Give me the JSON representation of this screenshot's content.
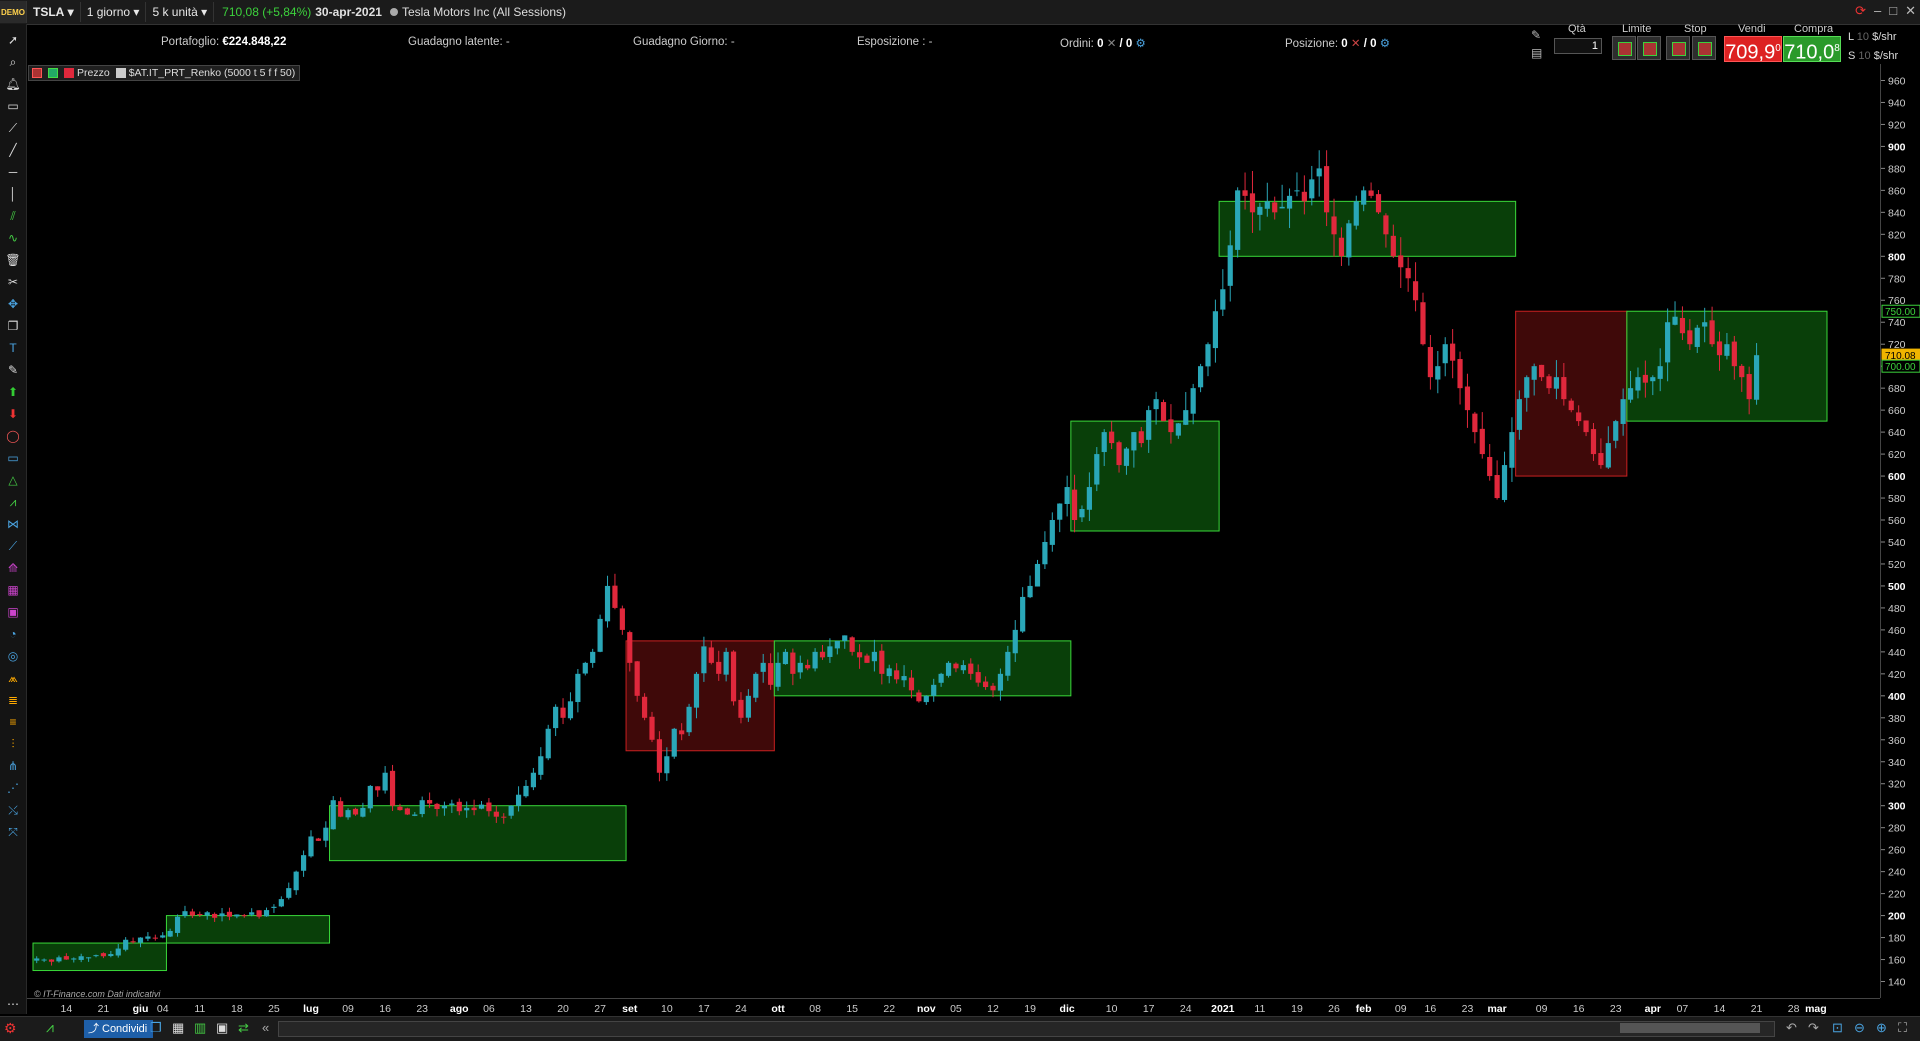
{
  "topbar": {
    "symbol": "TSLA",
    "timeframe": "1 giorno",
    "units": "5 k unità",
    "last_price": "710,08 (+5,84%)",
    "date": "30-apr-2021",
    "instrument": "Tesla Motors Inc (All Sessions)",
    "logo_text": "DEMO"
  },
  "infobar": {
    "portfolio_label": "Portafoglio:",
    "portfolio_value": "€224.848,22",
    "latent_label": "Guadagno latente:",
    "latent_value": "-",
    "daily_label": "Guadagno Giorno:",
    "daily_value": "-",
    "exposure_label": "Esposizione :",
    "exposure_value": "-",
    "orders_label": "Ordini:",
    "orders_value": "0",
    "orders_value2": "/ 0",
    "position_label": "Posizione:",
    "position_value": "0",
    "position_value2": "/ 0"
  },
  "orderpanel": {
    "qty_label": "Qtà",
    "qty_value": "1",
    "limit_label": "Limite",
    "stop_label": "Stop",
    "sell_label": "Vendi",
    "buy_label": "Compra",
    "sell_price": "709,9",
    "buy_price": "710,0",
    "sell_price_sup": "0",
    "buy_price_sup": "8",
    "l_label": "L",
    "s_label": "S",
    "l_qty": "10",
    "s_qty": "10",
    "unit": "$/shr"
  },
  "legend": {
    "price_label": "Prezzo",
    "indicator_label": "$AT.IT_PRT_Renko (5000 t 5 f f 50)"
  },
  "credit": "© IT-Finance.com Dati indicativi",
  "bottombar": {
    "share_label": "Condividi"
  },
  "colors": {
    "up": "#2aa7b8",
    "down": "#e0283c",
    "band_green": "#0b4a0b",
    "band_red": "#4a0b0b",
    "band_edge_green": "#39d839",
    "band_edge_red": "#c82020"
  },
  "chart_data": {
    "type": "candlestick",
    "ylim": [
      125,
      975
    ],
    "y_ticks": [
      140,
      160,
      180,
      200,
      220,
      240,
      260,
      280,
      300,
      320,
      340,
      360,
      380,
      400,
      420,
      440,
      460,
      480,
      500,
      520,
      540,
      560,
      580,
      600,
      620,
      640,
      660,
      680,
      700,
      720,
      740,
      760,
      780,
      800,
      820,
      840,
      860,
      880,
      900,
      920,
      940,
      960
    ],
    "y_bold_ticks": [
      200,
      300,
      400,
      500,
      600,
      700,
      800,
      900
    ],
    "y_markers": [
      {
        "value": 750,
        "label": "750.00",
        "color": "#3cd23c"
      },
      {
        "value": 710.08,
        "label": "710.08",
        "color": "#f0b400"
      },
      {
        "value": 700,
        "label": "700.00",
        "color": "#3cd23c"
      }
    ],
    "x_ticks": [
      {
        "i": 4,
        "label": "14"
      },
      {
        "i": 9,
        "label": "21"
      },
      {
        "i": 14,
        "label": "giu",
        "bold": true
      },
      {
        "i": 17,
        "label": "04"
      },
      {
        "i": 22,
        "label": "11"
      },
      {
        "i": 27,
        "label": "18"
      },
      {
        "i": 32,
        "label": "25"
      },
      {
        "i": 37,
        "label": "lug",
        "bold": true
      },
      {
        "i": 42,
        "label": "09"
      },
      {
        "i": 47,
        "label": "16"
      },
      {
        "i": 52,
        "label": "23"
      },
      {
        "i": 57,
        "label": "ago",
        "bold": true
      },
      {
        "i": 61,
        "label": "06"
      },
      {
        "i": 66,
        "label": "13"
      },
      {
        "i": 71,
        "label": "20"
      },
      {
        "i": 76,
        "label": "27"
      },
      {
        "i": 80,
        "label": "set",
        "bold": true
      },
      {
        "i": 85,
        "label": "10"
      },
      {
        "i": 90,
        "label": "17"
      },
      {
        "i": 95,
        "label": "24"
      },
      {
        "i": 100,
        "label": "ott",
        "bold": true
      },
      {
        "i": 105,
        "label": "08"
      },
      {
        "i": 110,
        "label": "15"
      },
      {
        "i": 115,
        "label": "22"
      },
      {
        "i": 120,
        "label": "nov",
        "bold": true
      },
      {
        "i": 124,
        "label": "05"
      },
      {
        "i": 129,
        "label": "12"
      },
      {
        "i": 134,
        "label": "19"
      },
      {
        "i": 139,
        "label": "dic",
        "bold": true
      },
      {
        "i": 145,
        "label": "10"
      },
      {
        "i": 150,
        "label": "17"
      },
      {
        "i": 155,
        "label": "24"
      },
      {
        "i": 160,
        "label": "2021",
        "bold": true
      },
      {
        "i": 165,
        "label": "11"
      },
      {
        "i": 170,
        "label": "19"
      },
      {
        "i": 175,
        "label": "26"
      },
      {
        "i": 179,
        "label": "feb",
        "bold": true
      },
      {
        "i": 184,
        "label": "09"
      },
      {
        "i": 188,
        "label": "16"
      },
      {
        "i": 193,
        "label": "23"
      },
      {
        "i": 197,
        "label": "mar",
        "bold": true
      },
      {
        "i": 203,
        "label": "09"
      },
      {
        "i": 208,
        "label": "16"
      },
      {
        "i": 213,
        "label": "23"
      },
      {
        "i": 218,
        "label": "apr",
        "bold": true
      },
      {
        "i": 222,
        "label": "07"
      },
      {
        "i": 227,
        "label": "14"
      },
      {
        "i": 232,
        "label": "21"
      },
      {
        "i": 237,
        "label": "28"
      },
      {
        "i": 240,
        "label": "mag",
        "bold": true
      }
    ],
    "n_bars": 242,
    "closes": [
      161,
      160,
      158,
      162,
      160,
      161,
      163,
      162,
      164,
      163,
      165,
      170,
      178,
      176,
      180,
      181,
      179,
      182,
      186,
      199,
      204,
      200,
      201,
      203,
      198,
      202,
      199,
      201,
      200,
      203,
      199,
      205,
      208,
      215,
      225,
      240,
      255,
      272,
      268,
      280,
      305,
      290,
      296,
      292,
      298,
      318,
      314,
      330,
      300,
      296,
      292,
      292,
      305,
      302,
      297,
      300,
      302,
      295,
      298,
      296,
      301,
      295,
      290,
      290,
      300,
      310,
      318,
      330,
      345,
      370,
      390,
      380,
      395,
      420,
      430,
      440,
      470,
      500,
      480,
      460,
      430,
      400,
      380,
      360,
      330,
      345,
      370,
      365,
      390,
      420,
      445,
      430,
      420,
      440,
      395,
      380,
      400,
      420,
      430,
      410,
      430,
      440,
      420,
      430,
      425,
      440,
      435,
      445,
      450,
      455,
      440,
      435,
      430,
      440,
      420,
      425,
      415,
      418,
      405,
      395,
      400,
      410,
      420,
      430,
      425,
      428,
      420,
      412,
      408,
      405,
      420,
      440,
      460,
      490,
      500,
      520,
      540,
      560,
      575,
      590,
      560,
      570,
      590,
      620,
      640,
      630,
      610,
      625,
      640,
      630,
      660,
      670,
      650,
      640,
      648,
      660,
      680,
      700,
      720,
      750,
      770,
      810,
      860,
      855,
      840,
      845,
      850,
      840,
      845,
      855,
      860,
      850,
      870,
      880,
      840,
      820,
      800,
      830,
      850,
      860,
      855,
      840,
      820,
      800,
      790,
      780,
      760,
      720,
      690,
      700,
      720,
      705,
      680,
      660,
      640,
      620,
      600,
      580,
      610,
      640,
      670,
      690,
      700,
      690,
      680,
      690,
      670,
      660,
      650,
      640,
      620,
      610,
      630,
      650,
      670,
      680,
      690,
      685,
      690,
      700,
      740,
      745,
      730,
      720,
      735,
      740,
      720,
      710,
      720,
      700,
      690,
      670,
      710
    ],
    "bands": [
      {
        "from": 0,
        "to": 18,
        "low": 150,
        "high": 175,
        "color": "green"
      },
      {
        "from": 18,
        "to": 40,
        "low": 175,
        "high": 200,
        "color": "green"
      },
      {
        "from": 40,
        "to": 80,
        "low": 250,
        "high": 300,
        "color": "green"
      },
      {
        "from": 80,
        "to": 100,
        "low": 350,
        "high": 450,
        "color": "red"
      },
      {
        "from": 100,
        "to": 140,
        "low": 400,
        "high": 450,
        "color": "green"
      },
      {
        "from": 140,
        "to": 160,
        "low": 550,
        "high": 650,
        "color": "green"
      },
      {
        "from": 160,
        "to": 200,
        "low": 800,
        "high": 850,
        "color": "green"
      },
      {
        "from": 200,
        "to": 215,
        "low": 600,
        "high": 750,
        "color": "red"
      },
      {
        "from": 215,
        "to": 242,
        "low": 650,
        "high": 750,
        "color": "green"
      }
    ]
  }
}
